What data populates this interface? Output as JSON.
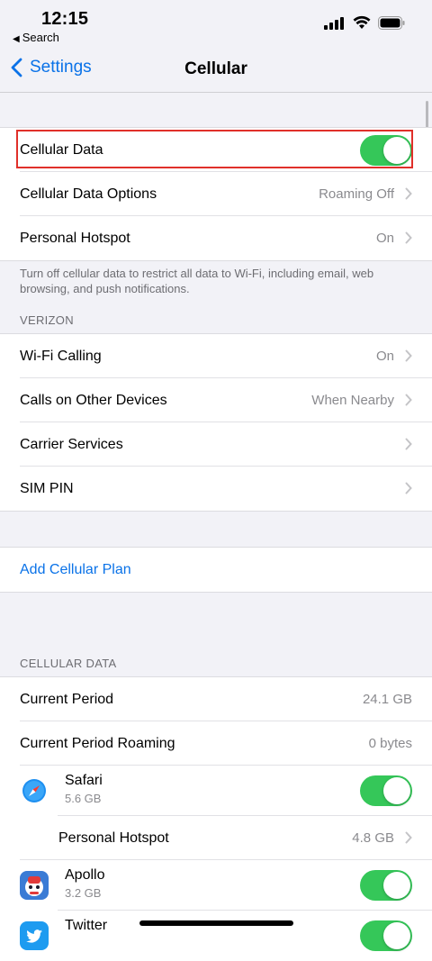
{
  "status": {
    "time": "12:15",
    "back_app": "Search"
  },
  "nav": {
    "back_label": "Settings",
    "title": "Cellular"
  },
  "section1": {
    "cellular_data": {
      "label": "Cellular Data",
      "on": true
    },
    "options": {
      "label": "Cellular Data Options",
      "value": "Roaming Off"
    },
    "hotspot": {
      "label": "Personal Hotspot",
      "value": "On"
    }
  },
  "footnote": "Turn off cellular data to restrict all data to Wi-Fi, including email, web browsing, and push notifications.",
  "carrier_header": "VERIZON",
  "carrier": {
    "wifi_calling": {
      "label": "Wi-Fi Calling",
      "value": "On"
    },
    "other_devices": {
      "label": "Calls on Other Devices",
      "value": "When Nearby"
    },
    "carrier_services": {
      "label": "Carrier Services"
    },
    "sim_pin": {
      "label": "SIM PIN"
    }
  },
  "add_plan": "Add Cellular Plan",
  "usage_header": "CELLULAR DATA",
  "usage": {
    "current_period": {
      "label": "Current Period",
      "value": "24.1 GB"
    },
    "current_roaming": {
      "label": "Current Period Roaming",
      "value": "0 bytes"
    },
    "safari": {
      "name": "Safari",
      "size": "5.6 GB",
      "on": true
    },
    "personal_hotspot": {
      "label": "Personal Hotspot",
      "value": "4.8 GB"
    },
    "apollo": {
      "name": "Apollo",
      "size": "3.2 GB",
      "on": true
    },
    "twitter": {
      "name": "Twitter",
      "on": true
    }
  },
  "icons": {
    "back": "chevron-left-icon",
    "row": "chevron-right-icon"
  },
  "colors": {
    "accent": "#0a72e8",
    "toggle_on": "#35c759",
    "highlight": "#e0302a"
  }
}
